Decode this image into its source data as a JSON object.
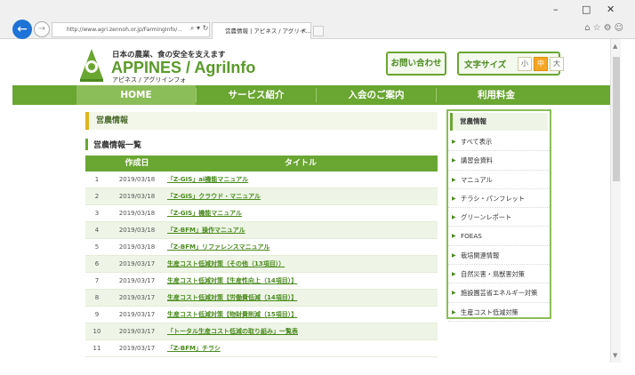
{
  "browser": {
    "address": "http://www.agri.zennoh.or.jp/FarmingInfo/...",
    "tab_title": "営農情報 | アピネス / アグリイ...",
    "tab_close": "×",
    "window_controls": [
      "–",
      "□",
      "✕"
    ]
  },
  "header": {
    "tagline": "日本の農業、食の安全を支えます",
    "brand": "APPINES / AgriInfo",
    "brand_sub": "アピネス / アグリインフォ",
    "contact_label": "お問い合わせ",
    "fontsize_label": "文字サイズ",
    "fontsize_options": [
      "小",
      "中",
      "大"
    ],
    "fontsize_selected": "中"
  },
  "nav": {
    "items": [
      "HOME",
      "サービス紹介",
      "入会のご案内",
      "利用料金"
    ],
    "active": "HOME"
  },
  "main": {
    "section_title": "営農情報",
    "subtitle": "営農情報一覧",
    "columns": [
      "作成日",
      "タイトル"
    ],
    "rows": [
      {
        "num": "1",
        "date": "2019/03/18",
        "title": "「Z-GIS」ai機能マニュアル"
      },
      {
        "num": "2",
        "date": "2019/03/18",
        "title": "「Z-GIS」クラウド・マニュアル"
      },
      {
        "num": "3",
        "date": "2019/03/18",
        "title": "「Z-GIS」機能マニュアル"
      },
      {
        "num": "4",
        "date": "2019/03/18",
        "title": "「Z-BFM」操作マニュアル"
      },
      {
        "num": "5",
        "date": "2019/03/18",
        "title": "「Z-BFM」リファレンスマニュアル"
      },
      {
        "num": "6",
        "date": "2019/03/17",
        "title": "生産コスト低減対策（その他（13項目））"
      },
      {
        "num": "7",
        "date": "2019/03/17",
        "title": "生産コスト低減対策【生産性向上（14項目）】"
      },
      {
        "num": "8",
        "date": "2019/03/17",
        "title": "生産コスト低減対策【労働費低減（14項目）】"
      },
      {
        "num": "9",
        "date": "2019/03/17",
        "title": "生産コスト低減対策【物財費削減（15項目）】"
      },
      {
        "num": "10",
        "date": "2019/03/17",
        "title": "「トータル生産コスト低減の取り組み」一覧表"
      },
      {
        "num": "11",
        "date": "2019/03/17",
        "title": "「Z-BFM」チラシ"
      }
    ]
  },
  "sidebar": {
    "title": "営農情報",
    "items": [
      "すべて表示",
      "講習会資料",
      "マニュアル",
      "チラシ・パンフレット",
      "グリーンレポート",
      "FOEAS",
      "栽培関連情報",
      "自然災害・鳥獣害対策",
      "施設園芸省エネルギー対策",
      "生産コスト低減対策"
    ]
  },
  "colors": {
    "brand_green": "#6aa632",
    "link_green": "#4a8a1e",
    "accent_orange": "#f5a623",
    "browser_back": "#1e73d6"
  }
}
